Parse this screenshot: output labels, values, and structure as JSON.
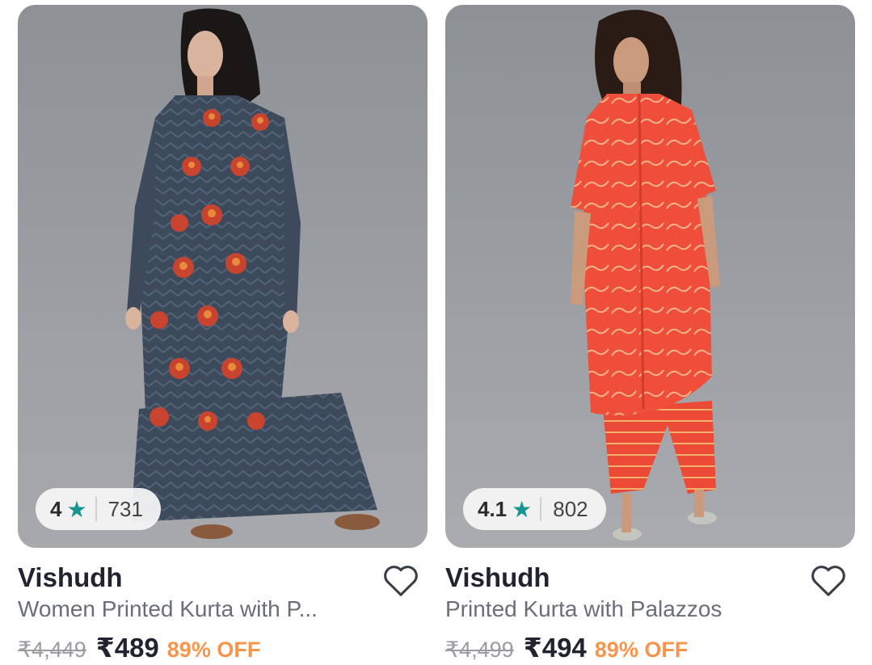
{
  "products": [
    {
      "rating": "4",
      "rating_count": "731",
      "brand": "Vishudh",
      "title": "Women Printed Kurta with P...",
      "mrp": "₹4,449",
      "price": "₹489",
      "discount": "89% OFF",
      "star_icon": "star-icon",
      "wishlist_icon": "heart-icon"
    },
    {
      "rating": "4.1",
      "rating_count": "802",
      "brand": "Vishudh",
      "title": "Printed Kurta with Palazzos",
      "mrp": "₹4,499",
      "price": "₹494",
      "discount": "89% OFF",
      "star_icon": "star-icon",
      "wishlist_icon": "heart-icon"
    }
  ],
  "colors": {
    "rating_star": "#14958f",
    "discount": "#f7954d",
    "brand_text": "#1f2430",
    "title_text": "#6a6e7a",
    "mrp_text": "#9a9ca3"
  }
}
